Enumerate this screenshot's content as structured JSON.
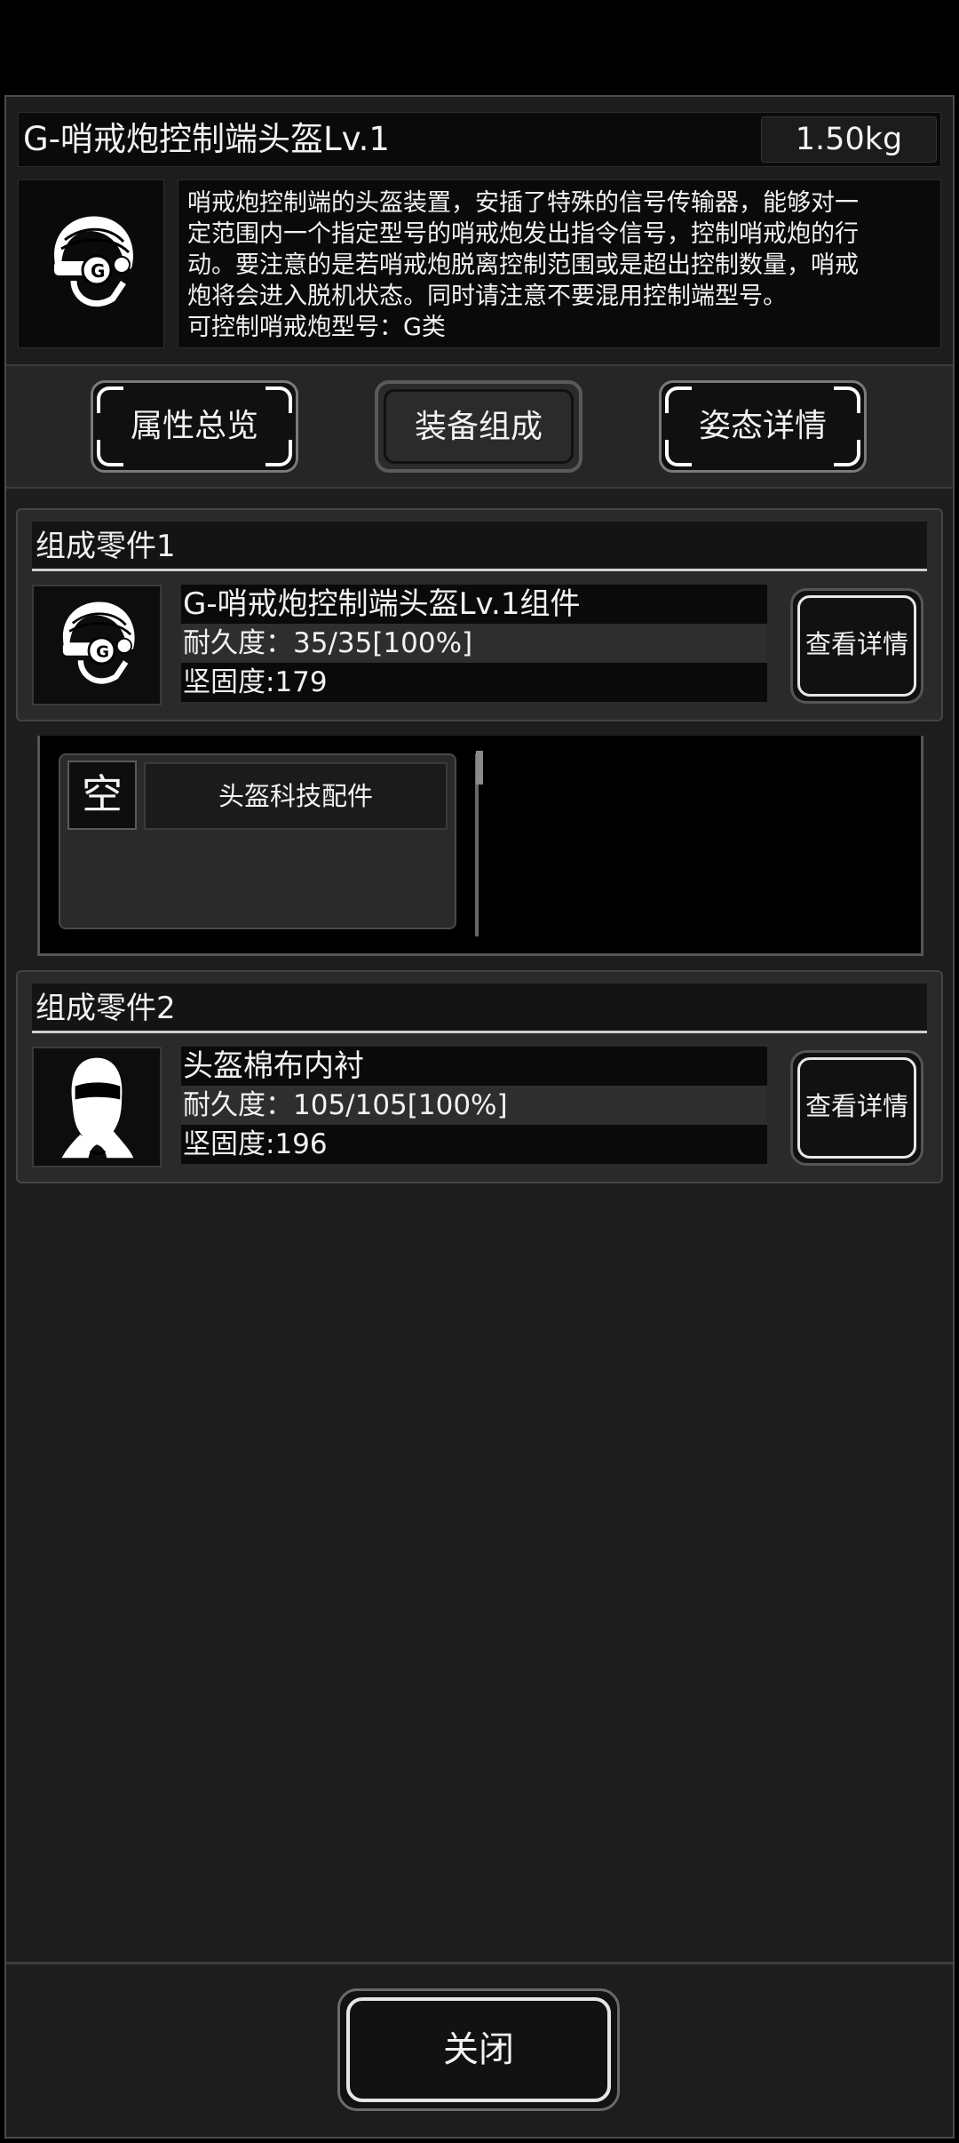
{
  "item": {
    "title": "G-哨戒炮控制端头盔Lv.1",
    "weight": "1.50kg",
    "icon": "helmet-icon",
    "description": [
      "哨戒炮控制端的头盔装置，安插了特殊的信号传输器，能够对一",
      "定范围内一个指定型号的哨戒炮发出指令信号，控制哨戒炮的行",
      "动。要注意的是若哨戒炮脱离控制范围或是超出控制数量，哨戒",
      "炮将会进入脱机状态。同时请注意不要混用控制端型号。",
      "可控制哨戒炮型号：G类"
    ]
  },
  "tabs": [
    {
      "label": "属性总览",
      "active": false
    },
    {
      "label": "装备组成",
      "active": true
    },
    {
      "label": "姿态详情",
      "active": false
    }
  ],
  "parts": [
    {
      "header": "组成零件1",
      "icon": "helmet-icon",
      "name": "G-哨戒炮控制端头盔Lv.1组件",
      "durability": "耐久度：35/35[100%]",
      "hardness": "坚固度:179",
      "detail_label": "查看详情"
    },
    {
      "header": "组成零件2",
      "icon": "balaclava-icon",
      "name": "头盔棉布内衬",
      "durability": "耐久度：105/105[100%]",
      "hardness": "坚固度:196",
      "detail_label": "查看详情"
    }
  ],
  "slot": {
    "empty_label": "空",
    "slot_name": "头盔科技配件"
  },
  "close_label": "关闭"
}
